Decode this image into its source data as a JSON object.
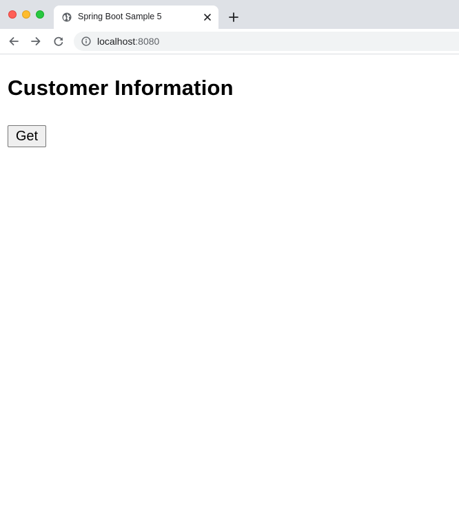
{
  "browser": {
    "tab": {
      "title": "Spring Boot Sample 5",
      "favicon": "globe-icon"
    },
    "address_bar": {
      "host": "localhost",
      "port": ":8080"
    },
    "icons": {
      "back": "arrow-left-icon",
      "forward": "arrow-right-icon",
      "reload": "reload-icon",
      "info": "info-icon",
      "close_tab": "close-icon",
      "new_tab": "plus-icon"
    },
    "colors": {
      "tabstrip": "#dee1e6",
      "omnibox": "#f1f3f4",
      "traffic_close": "#ff5f57",
      "traffic_min": "#febc2e",
      "traffic_max": "#28c840"
    }
  },
  "page": {
    "heading": "Customer Information",
    "get_button_label": "Get"
  }
}
